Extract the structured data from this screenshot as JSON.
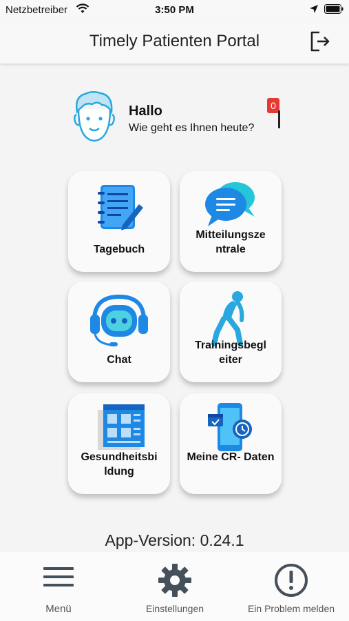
{
  "status_bar": {
    "carrier": "Netzbetreiber",
    "time": "3:50 PM"
  },
  "header": {
    "title": "Timely Patienten Portal",
    "logout_icon": "logout-icon"
  },
  "greeting": {
    "title": "Hallo",
    "subtitle": "Wie geht es Ihnen heute?",
    "badge_count": "0"
  },
  "tiles": [
    {
      "label": "Tagebuch",
      "icon": "diary-icon"
    },
    {
      "label": "Mitteilungsze ntrale",
      "icon": "chat-bubbles-icon"
    },
    {
      "label": "Chat",
      "icon": "robot-headset-icon"
    },
    {
      "label": "Trainingsbegl eiter",
      "icon": "exercise-icon"
    },
    {
      "label": "Gesundheitsbi ldung",
      "icon": "article-icon"
    },
    {
      "label": "Meine CR- Daten",
      "icon": "phone-data-icon"
    }
  ],
  "version": "App-Version: 0.24.1",
  "bottom_nav": [
    {
      "label": "Menü",
      "icon": "hamburger-menu-icon"
    },
    {
      "label": "Einstellungen",
      "icon": "gear-icon"
    },
    {
      "label": "Ein Problem melden",
      "icon": "alert-circle-icon"
    }
  ],
  "colors": {
    "accent": "#29a8e0",
    "badge": "#e53935"
  }
}
